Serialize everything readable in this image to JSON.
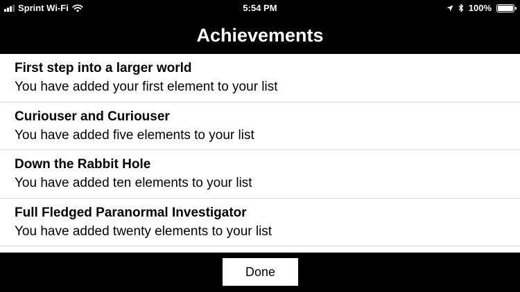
{
  "status_bar": {
    "carrier": "Sprint Wi-Fi",
    "time": "5:54 PM",
    "battery": "100%",
    "battery_level": 1.0,
    "icons": [
      "signal-icon",
      "wifi-icon",
      "location-icon",
      "bluetooth-icon",
      "battery-icon"
    ]
  },
  "header": {
    "title": "Achievements"
  },
  "achievements": [
    {
      "title": "First step into a larger world",
      "description": "You have added your first element to your list"
    },
    {
      "title": "Curiouser and Curiouser",
      "description": "You have added five elements to your list"
    },
    {
      "title": "Down the Rabbit Hole",
      "description": "You have added ten elements to your list"
    },
    {
      "title": "Full Fledged Paranormal Investigator",
      "description": "You have added twenty elements to your list"
    }
  ],
  "footer": {
    "done_label": "Done"
  },
  "colors": {
    "background": "#000000",
    "list_background": "#ffffff",
    "separator": "#d9d9d9",
    "text": "#000000"
  }
}
